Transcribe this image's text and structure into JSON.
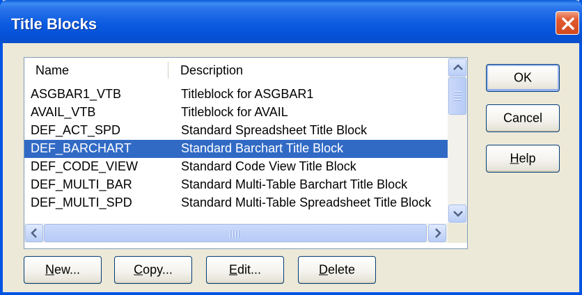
{
  "window": {
    "title": "Title Blocks"
  },
  "list": {
    "columns": [
      "Name",
      "Description"
    ],
    "rows": [
      {
        "name": "ASGBAR1_VTB",
        "description": "Titleblock for ASGBAR1"
      },
      {
        "name": "AVAIL_VTB",
        "description": "Titleblock for AVAIL"
      },
      {
        "name": "DEF_ACT_SPD",
        "description": "Standard Spreadsheet Title Block"
      },
      {
        "name": "DEF_BARCHART",
        "description": "Standard Barchart Title Block"
      },
      {
        "name": "DEF_CODE_VIEW",
        "description": "Standard Code View Title Block"
      },
      {
        "name": "DEF_MULTI_BAR",
        "description": "Standard Multi-Table Barchart Title Block"
      },
      {
        "name": "DEF_MULTI_SPD",
        "description": "Standard Multi-Table Spreadsheet Title Block"
      }
    ],
    "selected_index": 3
  },
  "buttons": {
    "ok": "OK",
    "cancel": "Cancel",
    "help_mnemonic": "H",
    "help_rest": "elp",
    "new_mnemonic": "N",
    "new_rest": "ew...",
    "copy_mnemonic": "C",
    "copy_rest": "opy...",
    "edit_mnemonic": "E",
    "edit_rest": "dit...",
    "delete_mnemonic": "D",
    "delete_rest": "elete"
  },
  "icons": {
    "close": "close-icon",
    "scroll_up": "scroll-up-arrow-icon",
    "scroll_down": "scroll-down-arrow-icon",
    "scroll_left": "scroll-left-arrow-icon",
    "scroll_right": "scroll-right-arrow-icon"
  },
  "colors": {
    "titlebar": "#0a5ad7",
    "selection": "#316ac5",
    "close_button": "#e2592f",
    "face": "#ece9d8"
  }
}
